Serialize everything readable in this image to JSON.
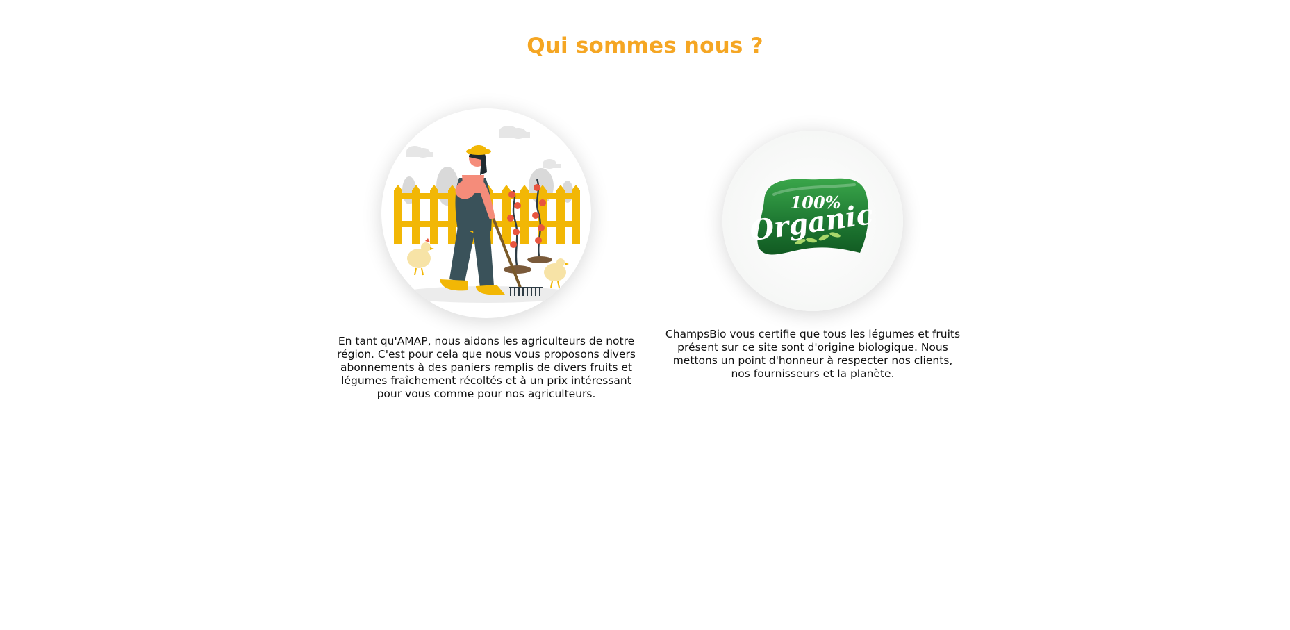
{
  "section": {
    "title": "Qui sommes nous ?"
  },
  "cards": [
    {
      "illustration": "farmer-raking-garden-illustration",
      "text": "En tant qu'AMAP, nous aidons les agriculteurs de notre région. C'est pour cela que nous vous proposons divers abonnements à des paniers remplis de divers fruits et légumes fraîchement récoltés et à un prix intéressant pour vous comme pour nos agriculteurs."
    },
    {
      "illustration": "organic-badge-illustration",
      "badge_top": "100%",
      "badge_word": "Organic",
      "text": "ChampsBio vous certifie que tous les légumes et fruits présent sur ce site sont d'origine biologique. Nous mettons un point d'honneur à respecter nos clients, nos fournisseurs et la planète."
    }
  ],
  "colors": {
    "title": "#f5a623",
    "text": "#111111",
    "badge_green": "#1f7a33",
    "fence_yellow": "#f2b705"
  }
}
